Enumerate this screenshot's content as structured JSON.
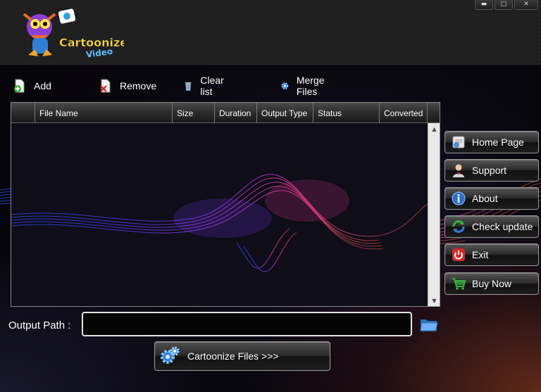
{
  "app": {
    "logo_text_1": "Cartoonize",
    "logo_text_2": "Video"
  },
  "window_controls": {
    "minimize": "▬",
    "maximize": "□",
    "close": "✕"
  },
  "toolbar": {
    "add": "Add",
    "remove": "Remove",
    "clear": "Clear list",
    "merge": "Merge Files"
  },
  "table": {
    "columns": [
      "",
      "File Name",
      "Size",
      "Duration",
      "Output Type",
      "Status",
      "Converted"
    ],
    "rows": []
  },
  "side": {
    "home": "Home Page",
    "support": "Support",
    "about": "About",
    "update": "Check update",
    "exit": "Exit",
    "buy": "Buy Now"
  },
  "output": {
    "label": "Output Path :",
    "value": ""
  },
  "action": {
    "cartoonize": "Cartoonize Files >>>"
  },
  "colors": {
    "accent_wave_blue": "#3a5cff",
    "accent_wave_pink": "#ff3fa8",
    "glow": "#b24a2a"
  }
}
